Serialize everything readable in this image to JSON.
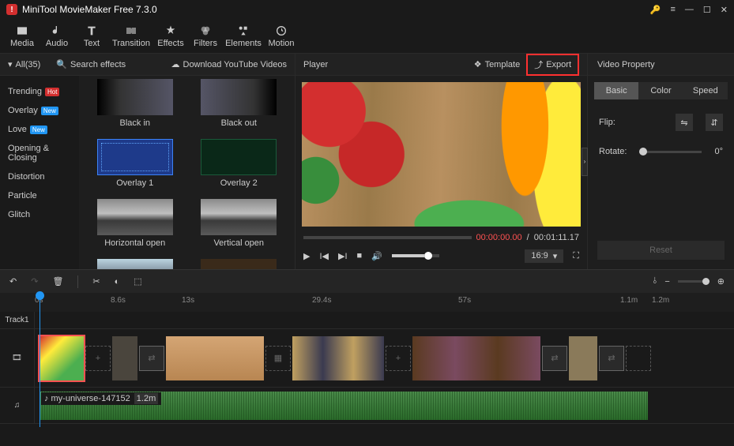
{
  "app": {
    "title": "MiniTool MovieMaker Free 7.3.0"
  },
  "toolbar": {
    "media": "Media",
    "audio": "Audio",
    "text": "Text",
    "transition": "Transition",
    "effects": "Effects",
    "filters": "Filters",
    "elements": "Elements",
    "motion": "Motion"
  },
  "filterbar": {
    "all": "All(35)",
    "search_ph": "Search effects",
    "download": "Download YouTube Videos"
  },
  "sidebar": {
    "items": [
      {
        "label": "Trending",
        "badge": "Hot"
      },
      {
        "label": "Overlay",
        "badge": "New"
      },
      {
        "label": "Love",
        "badge": "New"
      },
      {
        "label": "Opening & Closing"
      },
      {
        "label": "Distortion"
      },
      {
        "label": "Particle"
      },
      {
        "label": "Glitch"
      }
    ]
  },
  "effects": [
    {
      "label": "Black in"
    },
    {
      "label": "Black out"
    },
    {
      "label": "Overlay 1"
    },
    {
      "label": "Overlay 2"
    },
    {
      "label": "Horizontal open"
    },
    {
      "label": "Vertical open"
    }
  ],
  "player": {
    "title": "Player",
    "template": "Template",
    "export": "Export",
    "current": "00:00:00.00",
    "total": "00:01:11.17",
    "ratio": "16:9"
  },
  "props": {
    "title": "Video Property",
    "basic": "Basic",
    "color": "Color",
    "speed": "Speed",
    "flip": "Flip:",
    "rotate": "Rotate:",
    "rot_val": "0°",
    "reset": "Reset"
  },
  "ruler": {
    "marks": [
      "0s",
      "8.6s",
      "13s",
      "29.4s",
      "57s",
      "1.1m",
      "1.2m"
    ]
  },
  "tracks": {
    "track1": "Track1",
    "audio_name": "my-universe-147152",
    "audio_dur": "1.2m"
  }
}
